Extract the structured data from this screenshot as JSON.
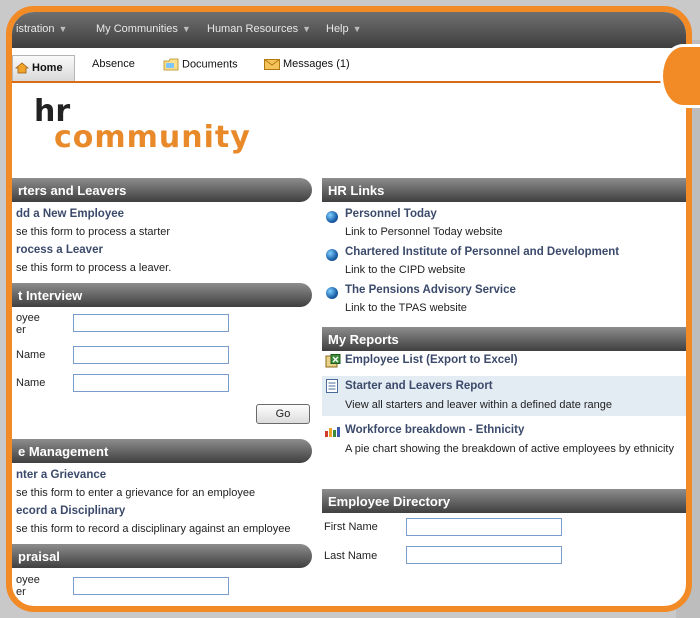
{
  "menubar": {
    "items": [
      "istration",
      "My Communities",
      "Human Resources",
      "Help"
    ]
  },
  "tabs": {
    "home": "Home",
    "absence": "Absence",
    "documents": "Documents",
    "messages": "Messages (1)"
  },
  "logo": {
    "line1": "hr",
    "line2": "community"
  },
  "starters": {
    "title": "rters and Leavers",
    "add_link": "dd a New Employee",
    "add_desc": "se this form to process a starter",
    "leaver_link": "rocess a Leaver",
    "leaver_desc": "se this form to process a leaver."
  },
  "interview": {
    "title": "t Interview",
    "f1_label_a": "oyee",
    "f1_label_b": "er",
    "f2_label": "Name",
    "f3_label": "Name",
    "go": "Go"
  },
  "case_mgmt": {
    "title": "e Management",
    "grievance_link": "nter a Grievance",
    "grievance_desc": "se this form to enter a grievance for an employee",
    "disc_link": "ecord a Disciplinary",
    "disc_desc": "se this form to record a disciplinary against an employee"
  },
  "appraisal": {
    "title": "praisal",
    "f1_label_a": "oyee",
    "f1_label_b": "er"
  },
  "hr_links": {
    "title": "HR Links",
    "items": [
      {
        "title": "Personnel Today",
        "desc": "Link to Personnel Today website"
      },
      {
        "title": "Chartered Institute of Personnel and Development",
        "desc": "Link to the CIPD website"
      },
      {
        "title": "The Pensions Advisory Service",
        "desc": "Link to the TPAS website"
      }
    ]
  },
  "reports": {
    "title": "My Reports",
    "items": [
      {
        "title": "Employee List (Export to Excel)",
        "desc": ""
      },
      {
        "title": "Starter and Leavers Report",
        "desc": "View all starters and leaver within a defined date range"
      },
      {
        "title": "Workforce breakdown - Ethnicity",
        "desc": "A pie chart showing the breakdown of active employees by ethnicity"
      }
    ]
  },
  "directory": {
    "title": "Employee Directory",
    "first_label": "First Name",
    "last_label": "Last Name"
  }
}
